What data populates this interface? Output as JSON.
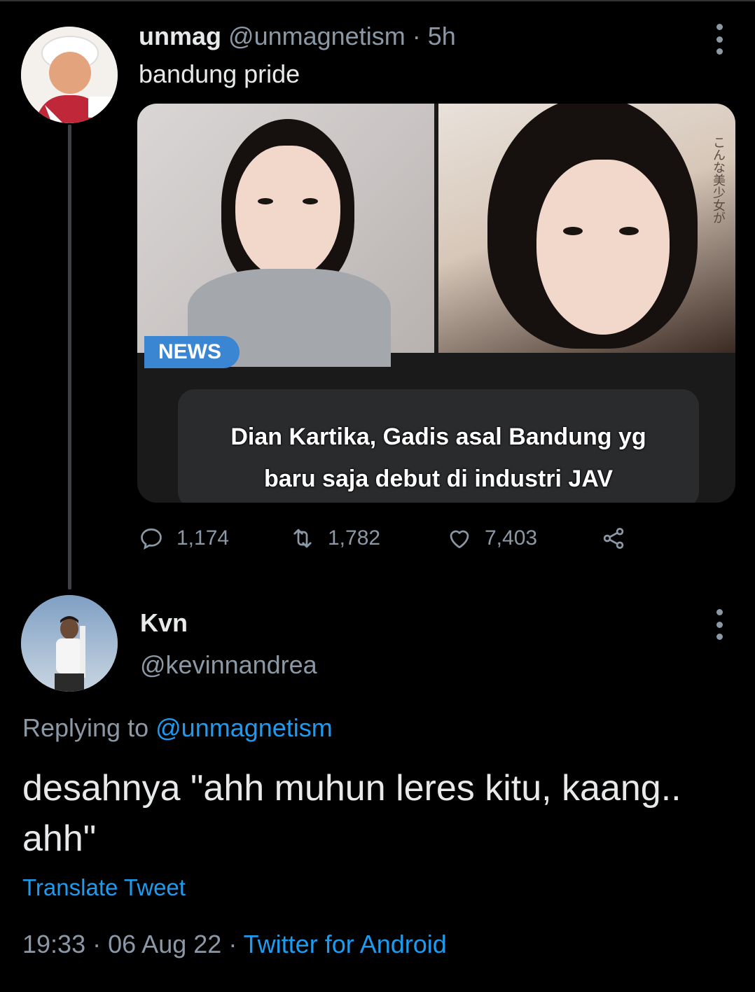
{
  "parent_tweet": {
    "name": "unmag",
    "handle": "@unmagnetism",
    "separator": "·",
    "time": "5h",
    "text": "bandung pride",
    "media": {
      "tag": "NEWS",
      "caption_line1": "Dian Kartika, Gadis asal Bandung yg",
      "caption_line2": "baru saja debut di industri JAV"
    },
    "stats": {
      "replies": "1,174",
      "retweets": "1,782",
      "likes": "7,403"
    }
  },
  "reply_tweet": {
    "name": "Kvn",
    "handle": "@kevinnandrea",
    "replying_prefix": "Replying to",
    "replying_handle": "@unmagnetism",
    "text": "desahnya \"ahh muhun leres kitu, kaang.. ahh\"",
    "translate_label": "Translate Tweet",
    "time": "19:33",
    "date": "06 Aug 22",
    "separator": "·",
    "source": "Twitter for Android"
  },
  "colors": {
    "background": "#000000",
    "text_primary": "#e7e9ea",
    "text_secondary": "#8b98a5",
    "link": "#1d9bf0"
  }
}
